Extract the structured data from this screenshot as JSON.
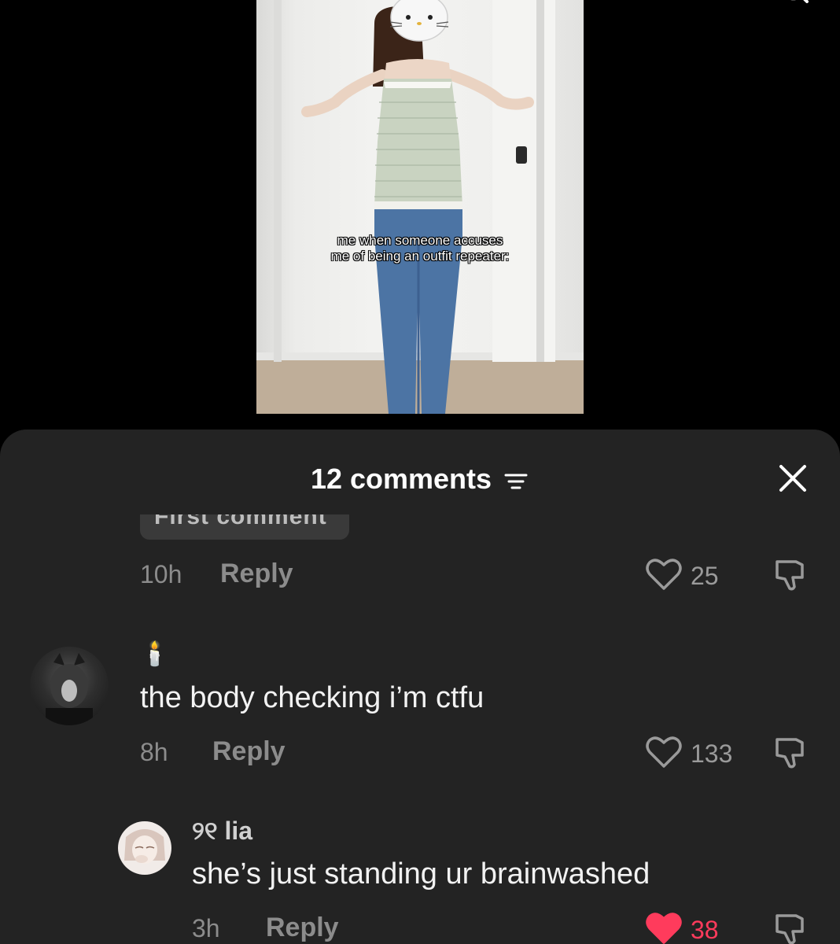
{
  "video": {
    "caption_line1": "me when someone accuses",
    "caption_line2": "me of being an outfit repeater:"
  },
  "header": {
    "search_icon": "search-icon"
  },
  "comments_sheet": {
    "title": "12 comments",
    "filter_icon": "filter-icon",
    "close_icon": "close-icon",
    "partial_comment_text": "First comment"
  },
  "comments": [
    {
      "time": "10h",
      "reply_label": "Reply",
      "likes": "25",
      "liked": false
    },
    {
      "username": "🕯️",
      "text": "the body checking i’m ctfu",
      "time": "8h",
      "reply_label": "Reply",
      "likes": "133",
      "liked": false
    },
    {
      "username": "୨୧ lia",
      "text": "she’s just standing ur brainwashed",
      "time": "3h",
      "reply_label": "Reply",
      "likes": "38",
      "liked": true
    }
  ],
  "colors": {
    "sheet_bg": "#232323",
    "muted_text": "#8c8c8c",
    "like_active": "#ff3b5c"
  }
}
